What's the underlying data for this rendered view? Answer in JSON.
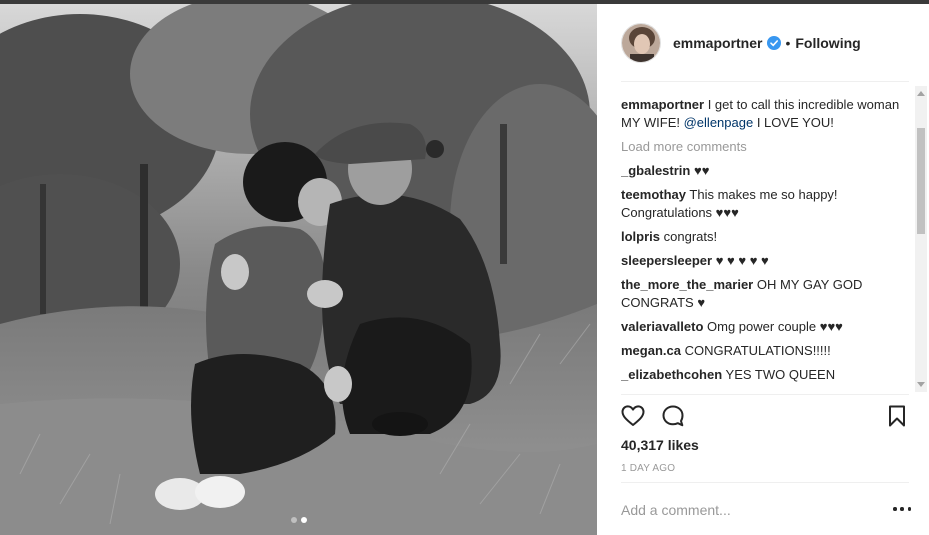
{
  "post": {
    "username": "emmaportner",
    "follow_status": "Following",
    "separator": "•",
    "caption_user": "emmaportner",
    "caption_text_1": "I get to call this incredible woman MY WIFE!",
    "caption_mention": "@ellenpage",
    "caption_text_2": "I LOVE YOU!",
    "load_more": "Load more comments",
    "comments": [
      {
        "user": "_gbalestrin",
        "text": "♥♥"
      },
      {
        "user": "teemothay",
        "text": "This makes me so happy! Congratulations ♥♥♥"
      },
      {
        "user": "lolpris",
        "text": "congrats!"
      },
      {
        "user": "sleepersleeper",
        "text": "♥ ♥ ♥ ♥ ♥"
      },
      {
        "user": "the_more_the_marier",
        "text": "OH MY GAY GOD CONGRATS ♥"
      },
      {
        "user": "valeriavalleto",
        "text": "Omg power couple ♥♥♥"
      },
      {
        "user": "megan.ca",
        "text": "CONGRATULATIONS!!!!!"
      },
      {
        "user": "_elizabethcohen",
        "text": "YES TWO QUEEN"
      }
    ],
    "likes": "40,317 likes",
    "time_ago": "1 DAY AGO",
    "add_comment_placeholder": "Add a comment...",
    "carousel": {
      "count": 2,
      "active": 2
    }
  },
  "icons": {
    "like": "heart-icon",
    "comment": "comment-bubble-icon",
    "save": "bookmark-icon",
    "verified": "verified-badge-icon",
    "options": "more-options-icon"
  },
  "colors": {
    "verified": "#3897f0",
    "mention": "#003569",
    "muted": "#999999",
    "text": "#262626"
  }
}
